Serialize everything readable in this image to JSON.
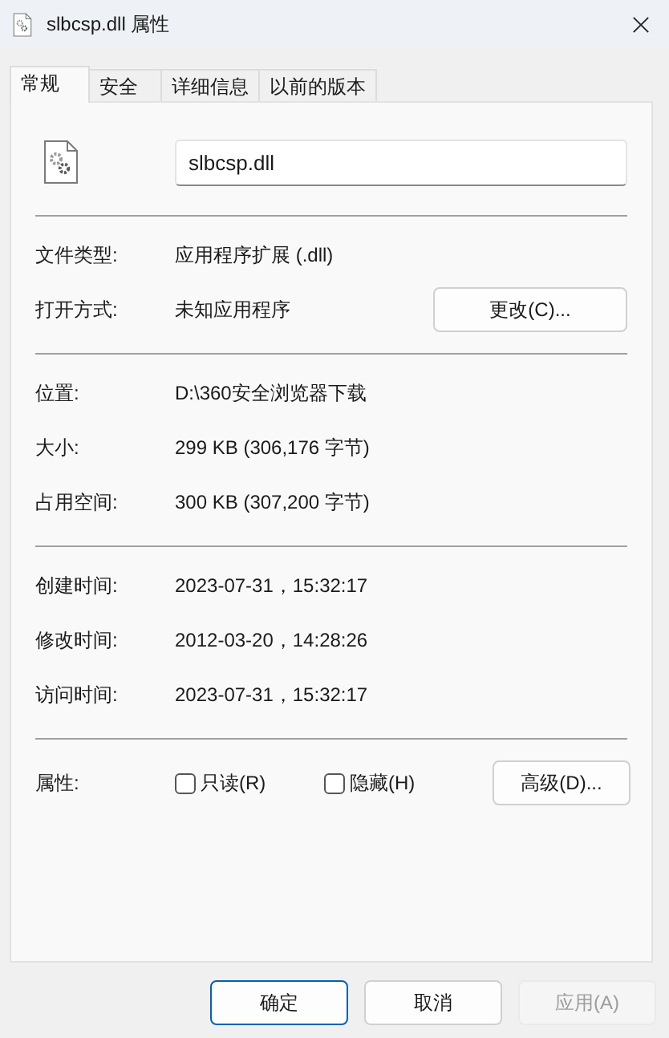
{
  "window": {
    "title": "slbcsp.dll 属性"
  },
  "tabs": [
    {
      "label": "常规",
      "selected": true
    },
    {
      "label": "安全",
      "selected": false
    },
    {
      "label": "详细信息",
      "selected": false
    },
    {
      "label": "以前的版本",
      "selected": false
    }
  ],
  "file_name": {
    "value": "slbcsp.dll"
  },
  "sections": [
    [
      {
        "label": "文件类型:",
        "value": "应用程序扩展 (.dll)"
      },
      {
        "label": "打开方式:",
        "value": "未知应用程序",
        "button": "更改(C)..."
      }
    ],
    [
      {
        "label": "位置:",
        "value": "D:\\360安全浏览器下载"
      },
      {
        "label": "大小:",
        "value": "299 KB (306,176 字节)"
      },
      {
        "label": "占用空间:",
        "value": "300 KB (307,200 字节)"
      }
    ],
    [
      {
        "label": "创建时间:",
        "value": "2023-07-31，15:32:17"
      },
      {
        "label": "修改时间:",
        "value": "2012-03-20，14:28:26"
      },
      {
        "label": "访问时间:",
        "value": "2023-07-31，15:32:17"
      }
    ]
  ],
  "attributes": {
    "label": "属性:",
    "checkboxes": [
      {
        "label": "只读(R)",
        "checked": false
      },
      {
        "label": "隐藏(H)",
        "checked": false
      }
    ],
    "button": "高级(D)..."
  },
  "buttons": [
    {
      "label": "确定",
      "default": true,
      "disabled": false
    },
    {
      "label": "取消",
      "default": false,
      "disabled": false
    },
    {
      "label": "应用(A)",
      "default": false,
      "disabled": true
    }
  ]
}
